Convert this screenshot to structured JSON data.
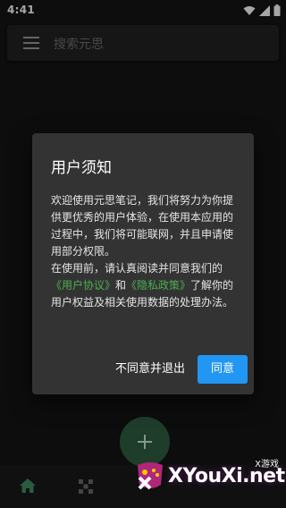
{
  "status_bar": {
    "time": "4:41",
    "icons": [
      "wifi-icon",
      "signal-icon",
      "battery-icon"
    ]
  },
  "search": {
    "placeholder": "搜索元思",
    "menu_icon": "menu-icon"
  },
  "dialog": {
    "title": "用户须知",
    "body_intro": "欢迎使用元思笔记，我们将努力为你提供更优秀的用户体验，在使用本应用的过程中，我们将可能联网，并且申请使用部分权限。",
    "body_before": "在使用前，请认真阅读并同意我们的",
    "link_agreement": "《用户协议》",
    "body_and": "和",
    "link_privacy": "《隐私政策》",
    "body_after": "了解你的用户权益及相关使用数据的处理办法。",
    "disagree_label": "不同意并退出",
    "agree_label": "同意"
  },
  "bottom_nav": {
    "items": [
      "home-icon",
      "grid-icon"
    ],
    "fab_icon": "add-icon"
  },
  "watermark": {
    "brand": "XYouXi.net",
    "tag": "X游戏"
  },
  "colors": {
    "background": "#141414",
    "dialog_bg": "#333333",
    "link": "#4caf50",
    "primary_button": "#2196f3",
    "fab": "#2f5e43",
    "home_active": "#3e8e63"
  }
}
